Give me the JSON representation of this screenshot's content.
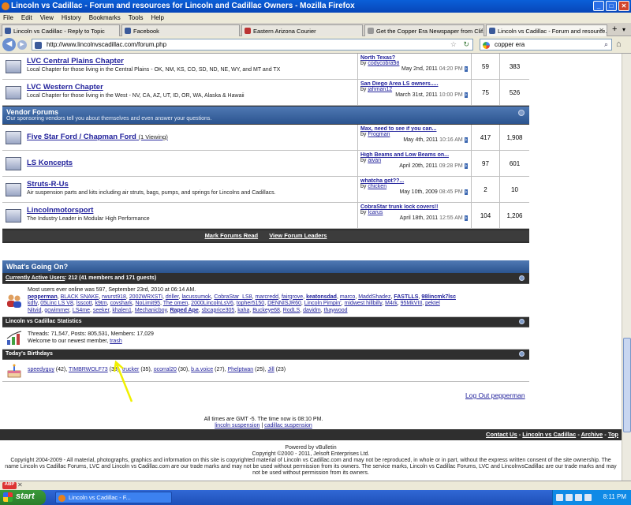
{
  "window": {
    "title": "Lincoln vs Cadillac - Forum and resources for Lincoln and Cadillac Owners - Mozilla Firefox"
  },
  "menu": [
    "File",
    "Edit",
    "View",
    "History",
    "Bookmarks",
    "Tools",
    "Help"
  ],
  "tabs": [
    "Lincoln vs Cadillac - Reply to Topic",
    "Facebook",
    "Eastern Arizona Courier",
    "Get the Copper Era Newspaper from Clif...",
    "Lincoln vs Cadillac - Forum and resource..."
  ],
  "nav": {
    "url": "http://www.lincolnvscadillac.com/forum.php",
    "search": "copper era"
  },
  "chapters": [
    {
      "title": "LVC Central Plains Chapter",
      "desc": "Local Chapter for those living in the Central Plains - OK, NM, KS, CO, SD, ND, NE, WY, and MT and TX",
      "last_title": "North Texas?",
      "last_by": "codycobra98",
      "last_date": "May 2nd, 2011",
      "last_time": "04:20 PM",
      "threads": "59",
      "posts": "383"
    },
    {
      "title": "LVC Western Chapter",
      "desc": "Local Chapter for those living in the West - NV, CA, AZ, UT, ID, OR, WA, Alaska & Hawaii",
      "last_title": "San Diego Area LS owners.....",
      "last_by": "jahman12",
      "last_date": "March 31st, 2011",
      "last_time": "10:00 PM",
      "threads": "75",
      "posts": "526"
    }
  ],
  "vendor": {
    "title": "Vendor Forums",
    "desc": "Our sponsoring vendors tell you about themselves and even answer your questions."
  },
  "vendors": [
    {
      "title": "Five Star Ford / Chapman Ford",
      "viewing": "(1 Viewing)",
      "desc": "",
      "last_title": "Max, need to see if you can...",
      "last_by": "Frogman",
      "last_date": "May 4th, 2011",
      "last_time": "10:16 AM",
      "threads": "417",
      "posts": "1,908"
    },
    {
      "title": "LS Koncepts",
      "viewing": "",
      "desc": "",
      "last_title": "High Beams and Low Beams on...",
      "last_by": "aivan",
      "last_date": "April 20th, 2011",
      "last_time": "09:28 PM",
      "threads": "97",
      "posts": "601"
    },
    {
      "title": "Struts-R-Us",
      "viewing": "",
      "desc": "Air suspension parts and kits including air struts, bags, pumps, and springs for Lincolns and Cadillacs.",
      "last_title": "whatcha got??...",
      "last_by": "chicken",
      "last_date": "May 10th, 2009",
      "last_time": "08:45 PM",
      "threads": "2",
      "posts": "10"
    },
    {
      "title": "Lincolnmotorsport",
      "viewing": "",
      "desc": "The Industry Leader in Modular High Performance",
      "last_title": "CobraStar trunk lock covers!!",
      "last_by": "Icarus",
      "last_date": "April 18th, 2011",
      "last_time": "12:55 AM",
      "threads": "104",
      "posts": "1,206"
    }
  ],
  "by_label": "by",
  "forum_links": [
    "Mark Forums Read",
    "View Forum Leaders"
  ],
  "wgo": {
    "title": "What's Going On?",
    "active_label": "Currently Active Users",
    "active_summary": ": 212 (41 members and 171 guests)",
    "most_users": "Most users ever online was 597, September 23rd, 2010 at 06:14 AM.",
    "users_line1": [
      "pepperman",
      "BLACK SNAKE",
      "rwurst918",
      "2002WRXSTi",
      "driller",
      "lacussumok",
      "CobraStar_LS8",
      "marcredd",
      "fairgrove",
      "keatonsdad",
      "marco",
      "MaddShadez",
      "FASTLLS",
      "98lincmk7lsc"
    ],
    "users_line2": [
      "kdfy",
      "05Linc LS V8",
      "lsscott",
      "k9tm",
      "covshark",
      "NoLimit95",
      "The omen",
      "2000LincolnLsV6",
      "topher5150",
      "DENNISJR60",
      "Lincoln Pimpin'",
      "midwest hillbilly",
      "M4rk",
      "95MkVIII",
      "pektel"
    ],
    "users_line3": [
      "Nitvid",
      "gcwimmer",
      "LS4me",
      "seeker",
      "khalen1",
      "Mechanicboy",
      "Raped Ape",
      "sbcaprice305",
      "kaha",
      "Buckeye68",
      "RodLS",
      "davidm",
      "thaywood"
    ],
    "stats_title": "Lincoln vs Cadillac Statistics",
    "stats_line": "Threads: 71,547, Posts: 805,531, Members: 17,029",
    "welcome": "Welcome to our newest member,",
    "newest": "trash",
    "bday_title": "Today's Birthdays",
    "birthdays": [
      "speedyguy (42)",
      "TIMBRWOLF73 (38)",
      "trucker (35)",
      "ocorral20 (30)",
      "b.a.voice (27)",
      "Phelptwan (25)",
      "Jill (23)"
    ]
  },
  "logout": "Log Out pepperman",
  "gmt": {
    "line": "All times are GMT -5. The time now is",
    "time": "08:10 PM.",
    "link1": "lincoln suspension",
    "link2": "cadillac suspension"
  },
  "footer_links": [
    "Contact Us",
    "Lincoln vs Cadillac",
    "Archive",
    "Top"
  ],
  "copyright": {
    "powered": "Powered by vBulletin",
    "vb": "Copyright ©2000 - 2011, Jelsoft Enterprises Ltd.",
    "text": "Copyright 2004-2009 - All material, photographs, graphics and information on this site is copyrighted material of Lincoln vs Cadillac.com and may not be reproduced, in whole or in part, without the express written consent of the site ownership. The name Lincoln vs Cadillac Forums, LVC and Lincoln vs Cadillac.com are our trade marks and may not be used without permission from its owners. The service marks, Lincoln vs Cadillac Forums, LVC and LincolnvsCadillac are our trade marks and may not be used without permission from its owners."
  },
  "taskbar": {
    "start": "start",
    "item": "Lincoln vs Cadillac - F...",
    "clock": "8:11 PM"
  }
}
